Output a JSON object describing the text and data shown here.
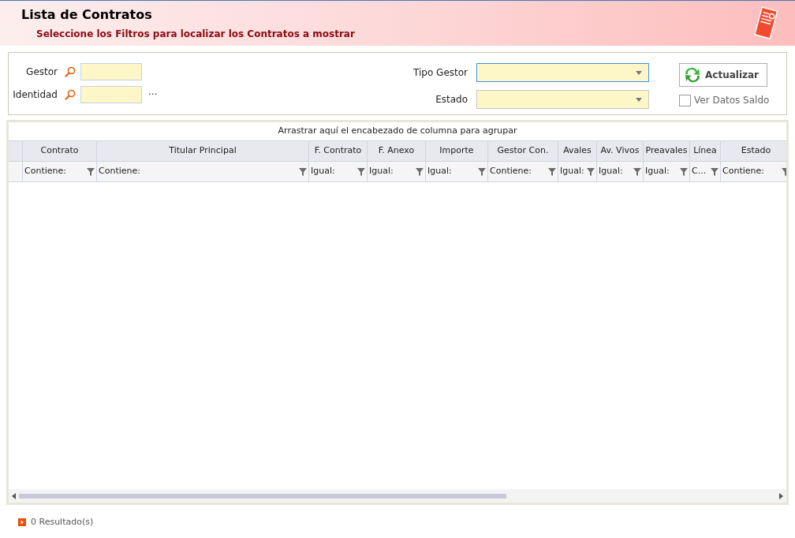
{
  "header": {
    "title": "Lista de Contratos",
    "subtitle": "Seleccione los Filtros para localizar los Contratos a mostrar"
  },
  "filters": {
    "gestor": {
      "label": "Gestor"
    },
    "identidad": {
      "label": "Identidad",
      "more": "···"
    },
    "tipo_gestor": {
      "label": "Tipo Gestor",
      "focused": true
    },
    "estado": {
      "label": "Estado",
      "focused": false
    },
    "refresh_button": "Actualizar",
    "saldo": {
      "label": "Ver Datos Saldo",
      "checked": false
    }
  },
  "grid": {
    "group_hint": "Arrastrar aquí el encabezado de columna para agrupar",
    "columns": [
      {
        "title": "Contrato",
        "filter": "Contiene:"
      },
      {
        "title": "Titular Principal",
        "filter": "Contiene:"
      },
      {
        "title": "F. Contrato",
        "filter": "Igual:"
      },
      {
        "title": "F. Anexo",
        "filter": "Igual:"
      },
      {
        "title": "Importe",
        "filter": "Igual:"
      },
      {
        "title": "Gestor Con.",
        "filter": "Contiene:"
      },
      {
        "title": "Avales",
        "filter": "Igual:"
      },
      {
        "title": "Av. Vivos",
        "filter": "Igual:"
      },
      {
        "title": "Preavales",
        "filter": "Igual:"
      },
      {
        "title": "Línea",
        "filter": "C..."
      },
      {
        "title": "Estado",
        "filter": "Contiene:"
      }
    ]
  },
  "status_bar": {
    "results": "0 Resultado(s)"
  }
}
